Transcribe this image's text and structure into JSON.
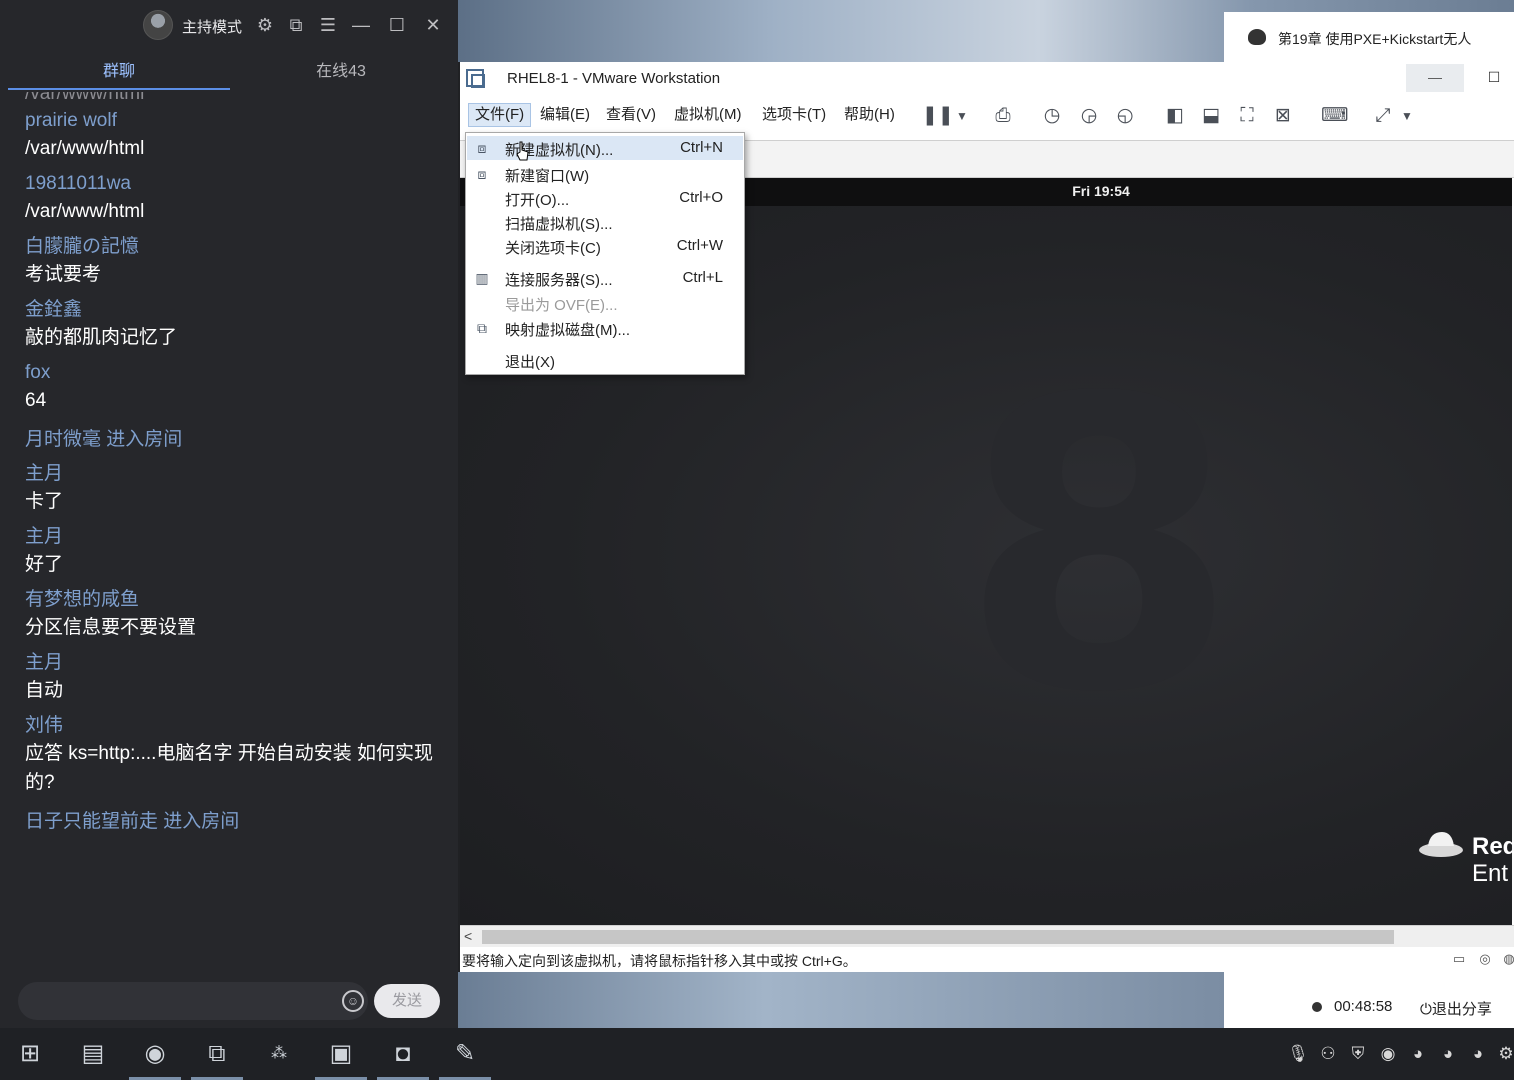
{
  "chat": {
    "mode_label": "主持模式",
    "tabs": {
      "chat": "群聊",
      "online": "在线43"
    },
    "cut_top_text": "/var/www/html",
    "messages": [
      {
        "name": "prairie wolf",
        "text": "/var/www/html"
      },
      {
        "name": "19811011wa",
        "text": "/var/www/html"
      },
      {
        "name": "白朦朧の記憶",
        "text": "考试要考"
      },
      {
        "name": "金銓鑫",
        "text": "敲的都肌肉记忆了"
      },
      {
        "name": "fox",
        "text": "64"
      },
      {
        "system": "月时微毫 进入房间"
      },
      {
        "name": "主月",
        "text": "卡了"
      },
      {
        "name": "主月",
        "text": "好了"
      },
      {
        "name": "有梦想的咸鱼",
        "text": "分区信息要不要设置"
      },
      {
        "name": "主月",
        "text": "自动"
      },
      {
        "name": "刘伟",
        "text": "应答   ks=http:....电脑名字  开始自动安装  如何实现的?"
      },
      {
        "system": "日子只能望前走 进入房间"
      }
    ],
    "input_placeholder": "",
    "send_label": "发送"
  },
  "lesson_tab": {
    "title": "第19章 使用PXE+Kickstart无人"
  },
  "vmware": {
    "title": "RHEL8-1 - VMware Workstation",
    "menus": [
      "文件(F)",
      "编辑(E)",
      "查看(V)",
      "虚拟机(M)",
      "选项卡(T)",
      "帮助(H)"
    ],
    "file_menu": [
      {
        "label": "新建虚拟机(N)...",
        "shortcut": "Ctrl+N",
        "icon": "new-vm-icon",
        "enabled": true
      },
      {
        "label": "新建窗口(W)",
        "shortcut": "",
        "icon": "new-window-icon",
        "enabled": true
      },
      {
        "label": "打开(O)...",
        "shortcut": "Ctrl+O",
        "icon": "",
        "enabled": true
      },
      {
        "label": "扫描虚拟机(S)...",
        "shortcut": "",
        "icon": "",
        "enabled": true
      },
      {
        "label": "关闭选项卡(C)",
        "shortcut": "Ctrl+W",
        "icon": "",
        "enabled": true
      },
      {
        "label": "连接服务器(S)...",
        "shortcut": "Ctrl+L",
        "icon": "server-icon",
        "enabled": true
      },
      {
        "label": "导出为 OVF(E)...",
        "shortcut": "",
        "icon": "",
        "enabled": false
      },
      {
        "label": "映射虚拟磁盘(M)...",
        "shortcut": "",
        "icon": "disk-icon",
        "enabled": true
      },
      {
        "label": "退出(X)",
        "shortcut": "",
        "icon": "",
        "enabled": true
      }
    ],
    "guest": {
      "clock": "Fri 19:54",
      "version_glyph": "8",
      "brand_line1": "Red",
      "brand_line2": "Ent"
    },
    "status_text": "要将输入定向到该虚拟机，请将鼠标指针移入其中或按 Ctrl+G。"
  },
  "share": {
    "time": "00:48:58",
    "exit_label": "退出分享"
  }
}
